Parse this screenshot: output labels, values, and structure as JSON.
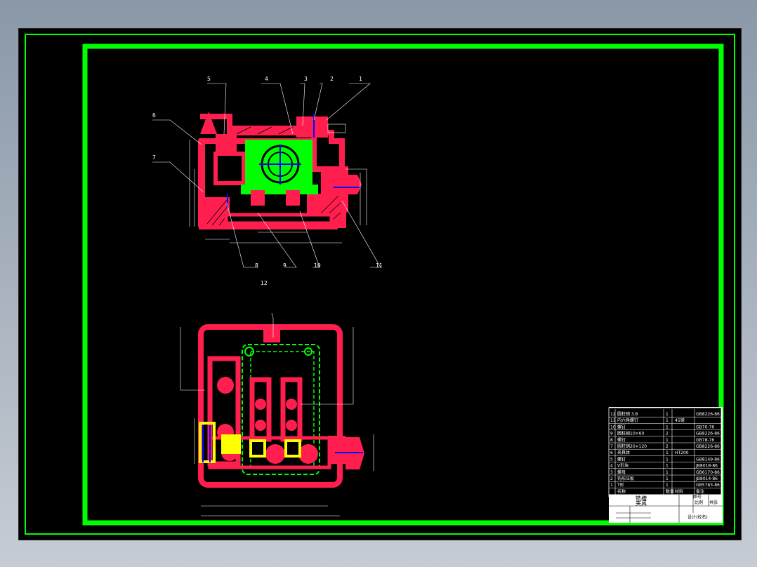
{
  "sheet": {
    "background": "#000000",
    "border_color": "#00ff00",
    "part_color": "#ff1e4e",
    "body_color": "#00ff00",
    "axis_color": "#0000ff",
    "insert_color": "#ffff00"
  },
  "front_view": {
    "balloons": [
      "5",
      "4",
      "3",
      "2",
      "1",
      "6",
      "7",
      "8",
      "9",
      "10",
      "11"
    ]
  },
  "top_view": {
    "balloons": [
      "12"
    ]
  },
  "parts_list": {
    "rows": [
      {
        "no": "12",
        "name": "圆柱销 3.8",
        "qty": "1",
        "material": "",
        "std": "GB8226-86"
      },
      {
        "no": "11",
        "name": "内六角螺钉",
        "qty": "1",
        "material": "45钢",
        "std": ""
      },
      {
        "no": "10",
        "name": "螺钉",
        "qty": "1",
        "material": "",
        "std": "GB70-76"
      },
      {
        "no": "9",
        "name": "圆柱销10×60",
        "qty": "2",
        "material": "",
        "std": "GB8226-86"
      },
      {
        "no": "8",
        "name": "螺钉",
        "qty": "1",
        "material": "",
        "std": "GB78-76"
      },
      {
        "no": "7",
        "name": "圆柱销20×120",
        "qty": "2",
        "material": "",
        "std": "GB8226-86"
      },
      {
        "no": "6",
        "name": "夹具体",
        "qty": "1",
        "material": "HT200",
        "std": ""
      },
      {
        "no": "5",
        "name": "螺钉",
        "qty": "1",
        "material": "",
        "std": "GB8149-86"
      },
      {
        "no": "4",
        "name": "V形块",
        "qty": "1",
        "material": "",
        "std": "JB8018-86"
      },
      {
        "no": "3",
        "name": "螺母",
        "qty": "1",
        "material": "",
        "std": "GB6170-86"
      },
      {
        "no": "2",
        "name": "钩形压板",
        "qty": "1",
        "material": "",
        "std": "JB8014-86"
      },
      {
        "no": "1",
        "name": "T形",
        "qty": "1",
        "material": "",
        "std": "GB5783-86"
      },
      {
        "no": "",
        "name": "名称",
        "qty": "数量",
        "material": "材料",
        "std": "备注"
      }
    ]
  },
  "title_block": {
    "title_line1": "铣槽",
    "title_line2": "夹具",
    "drawing_no": "图号",
    "ratio_label": "比例",
    "sheet_label": "共张",
    "school": "设计(校名)"
  }
}
